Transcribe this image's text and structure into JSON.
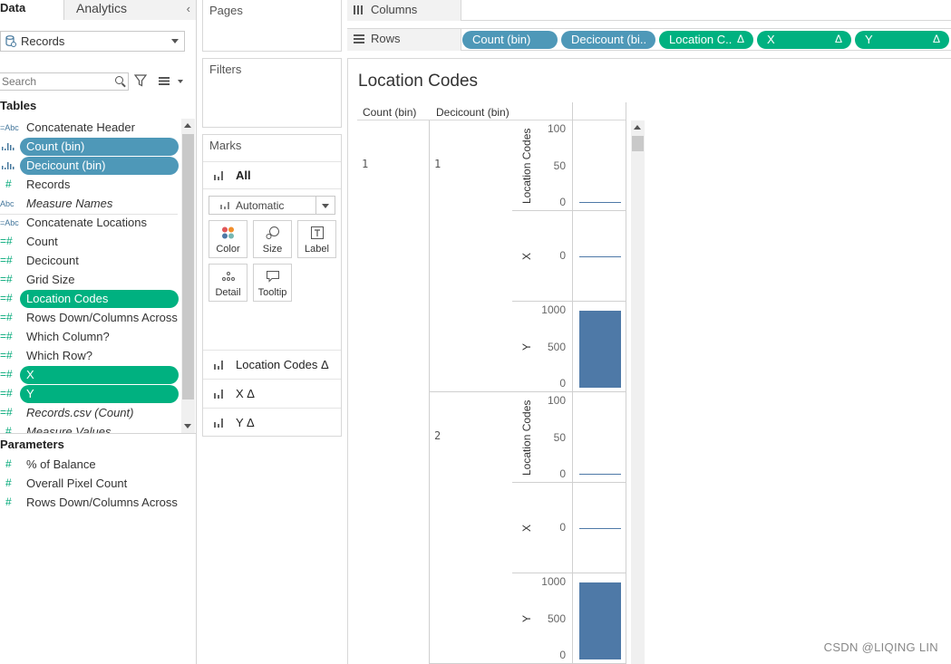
{
  "data_pane": {
    "tabs": {
      "data": "Data",
      "analytics": "Analytics"
    },
    "datasource": "Records",
    "search_placeholder": "Search",
    "tables_header": "Tables",
    "fields": [
      {
        "type": "Abc",
        "name": "Concatenate Header",
        "pill": ""
      },
      {
        "type": "bin",
        "name": "Count (bin)",
        "pill": "blue"
      },
      {
        "type": "bin",
        "name": "Decicount (bin)",
        "pill": "blue"
      },
      {
        "type": "#",
        "name": "Records",
        "pill": ""
      },
      {
        "type": "Abc",
        "name": "Measure Names",
        "pill": "",
        "italic": true
      },
      {
        "type": "Abc",
        "name": "Concatenate Locations",
        "pill": ""
      },
      {
        "type": "=#",
        "name": "Count",
        "pill": ""
      },
      {
        "type": "=#",
        "name": "Decicount",
        "pill": ""
      },
      {
        "type": "=#",
        "name": "Grid Size",
        "pill": ""
      },
      {
        "type": "=#",
        "name": "Location Codes",
        "pill": "green"
      },
      {
        "type": "=#",
        "name": "Rows Down/Columns Across",
        "pill": ""
      },
      {
        "type": "=#",
        "name": "Which Column?",
        "pill": ""
      },
      {
        "type": "=#",
        "name": "Which Row?",
        "pill": ""
      },
      {
        "type": "=#",
        "name": "X",
        "pill": "green"
      },
      {
        "type": "=#",
        "name": "Y",
        "pill": "green"
      },
      {
        "type": "=#",
        "name": "Records.csv (Count)",
        "pill": "",
        "italic": true
      },
      {
        "type": "#",
        "name": "Measure Values",
        "pill": "",
        "italic": true
      }
    ],
    "parameters_header": "Parameters",
    "parameters": [
      {
        "type": "#",
        "name": "% of Balance"
      },
      {
        "type": "#",
        "name": "Overall Pixel Count"
      },
      {
        "type": "#",
        "name": "Rows Down/Columns Across"
      }
    ]
  },
  "cards": {
    "pages": "Pages",
    "filters": "Filters",
    "marks": "Marks",
    "marks_all": "All",
    "mark_type": "Automatic",
    "buttons": [
      "Color",
      "Size",
      "Label",
      "Detail",
      "Tooltip"
    ],
    "mark_rows": [
      "Location Codes Δ",
      "X Δ",
      "Y Δ"
    ]
  },
  "shelves": {
    "columns": "Columns",
    "rows": "Rows",
    "row_pills": [
      {
        "label": "Count (bin)",
        "color": "#4e98b8",
        "delta": ""
      },
      {
        "label": "Decicount (bi..",
        "color": "#4e98b8",
        "delta": ""
      },
      {
        "label": "Location C..",
        "color": "#00b180",
        "delta": "Δ"
      },
      {
        "label": "X",
        "color": "#00b180",
        "delta": "Δ"
      },
      {
        "label": "Y",
        "color": "#00b180",
        "delta": "Δ"
      }
    ]
  },
  "viz": {
    "title": "Location Codes",
    "headers": {
      "col1": "Count (bin)",
      "col2": "Decicount (bin)"
    },
    "count_bin": "1",
    "panes": [
      {
        "decicount": "1",
        "charts": [
          {
            "axis": "Location Codes",
            "ticks": [
              "100",
              "50",
              "0"
            ]
          },
          {
            "axis": "X",
            "ticks": [
              "0"
            ]
          },
          {
            "axis": "Y",
            "ticks": [
              "1000",
              "500",
              "0"
            ]
          }
        ]
      },
      {
        "decicount": "2",
        "charts": [
          {
            "axis": "Location Codes",
            "ticks": [
              "100",
              "50",
              "0"
            ]
          },
          {
            "axis": "X",
            "ticks": [
              "0"
            ]
          },
          {
            "axis": "Y",
            "ticks": [
              "1000",
              "500",
              "0"
            ]
          }
        ]
      }
    ]
  },
  "chart_data": {
    "type": "bar",
    "title": "Location Codes",
    "categories": [
      "Decicount 1",
      "Decicount 2"
    ],
    "series": [
      {
        "name": "Location Codes",
        "values": [
          1,
          1
        ]
      },
      {
        "name": "X",
        "values": [
          0,
          0
        ]
      },
      {
        "name": "Y",
        "values": [
          1000,
          1000
        ]
      }
    ],
    "ylim_location_codes": [
      0,
      100
    ],
    "ylim_y": [
      0,
      1000
    ]
  },
  "watermark": "CSDN @LIQING LIN",
  "colors": {
    "blue_pill": "#4e98b8",
    "green_pill": "#00b180",
    "bar": "#4e79a7"
  }
}
